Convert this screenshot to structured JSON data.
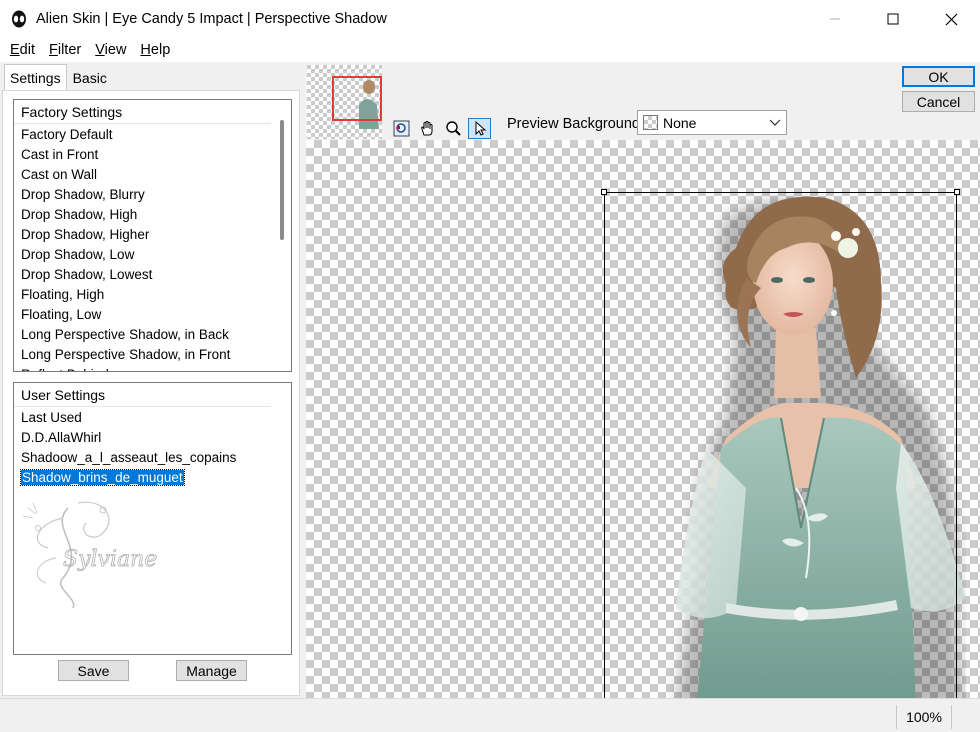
{
  "window": {
    "title": "Alien Skin | Eye Candy 5 Impact | Perspective Shadow"
  },
  "menu": [
    {
      "first": "E",
      "rest": "dit"
    },
    {
      "first": "F",
      "rest": "ilter"
    },
    {
      "first": "V",
      "rest": "iew"
    },
    {
      "first": "H",
      "rest": "elp"
    }
  ],
  "tabs": {
    "settings": "Settings",
    "basic": "Basic"
  },
  "factory": {
    "header": "Factory Settings",
    "items": [
      "Factory Default",
      "Cast in Front",
      "Cast on Wall",
      "Drop Shadow, Blurry",
      "Drop Shadow, High",
      "Drop Shadow, Higher",
      "Drop Shadow, Low",
      "Drop Shadow, Lowest",
      "Floating, High",
      "Floating, Low",
      "Long Perspective Shadow, in Back",
      "Long Perspective Shadow, in Front",
      "Reflect Behind"
    ]
  },
  "user": {
    "header": "User Settings",
    "items": [
      "Last Used",
      "D.D.AllaWhirl",
      "Shadoow_a_l_asseaut_les_copains",
      "Shadow_brins_de_muguet"
    ],
    "selected_index": 3
  },
  "watermark_text": "Sylviane",
  "buttons": {
    "save": "Save",
    "manage": "Manage",
    "ok": "OK",
    "cancel": "Cancel"
  },
  "toolbar": {
    "preview_bg_label": "Preview Background:",
    "preview_bg_value": "None",
    "active_tool": "arrow"
  },
  "icons": {
    "app": "alien-skin-logo",
    "tools": [
      "zoom-fit-icon",
      "hand-icon",
      "magnifier-icon",
      "arrow-pointer-icon"
    ]
  },
  "status": {
    "zoom": "100%"
  }
}
